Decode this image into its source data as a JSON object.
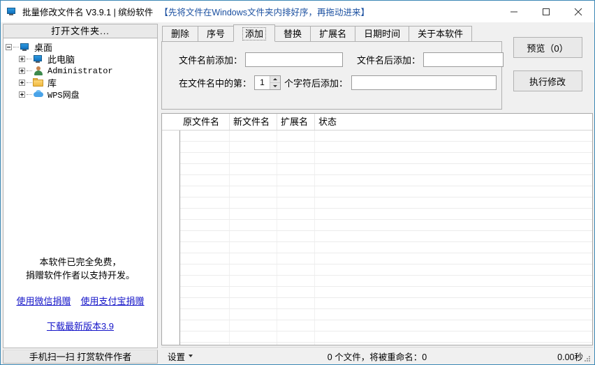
{
  "window": {
    "title": "批量修改文件名 V3.9.1 | 缤纷软件",
    "title_hint": "【先将文件在Windows文件夹内排好序，再拖动进来】",
    "icon": "monitor-icon",
    "controls": {
      "minimize": "—",
      "maximize": "□",
      "close": "✕"
    }
  },
  "sidebar": {
    "open_folder_label": "打开文件夹...",
    "tree": [
      {
        "label": "桌面",
        "level": 1,
        "expander": "minus",
        "icon": "desktop-monitor-icon"
      },
      {
        "label": "此电脑",
        "level": 2,
        "expander": "plus",
        "icon": "this-pc-monitor-icon"
      },
      {
        "label": "Administrator",
        "level": 2,
        "expander": "plus",
        "icon": "user-person-icon"
      },
      {
        "label": "库",
        "level": 2,
        "expander": "plus",
        "icon": "library-folder-icon"
      },
      {
        "label": "WPS网盘",
        "level": 2,
        "expander": "plus",
        "icon": "cloud-drive-icon"
      }
    ],
    "donate": {
      "line1": "本软件已完全免费，",
      "line2": "捐赠软件作者以支持开发。",
      "wechat_link": "使用微信捐赠",
      "alipay_link": "使用支付宝捐赠",
      "download_link": "下载最新版本3.9"
    },
    "scan_button": "手机扫一扫 打赏软件作者"
  },
  "tabs": [
    {
      "label": "删除",
      "selected": false
    },
    {
      "label": "序号",
      "selected": false
    },
    {
      "label": "添加",
      "selected": true
    },
    {
      "label": "替换",
      "selected": false
    },
    {
      "label": "扩展名",
      "selected": false
    },
    {
      "label": "日期时间",
      "selected": false
    },
    {
      "label": "关于本软件",
      "selected": false
    }
  ],
  "form": {
    "prefix_label": "文件名前添加：",
    "prefix_value": "",
    "suffix_label": "文件名后添加：",
    "suffix_value": "",
    "position_label_before": "在文件名中的第：",
    "position_value": "1",
    "position_label_after": "个字符后添加：",
    "position_insert_value": ""
  },
  "actions": {
    "preview_button": "预览（0）",
    "execute_button": "执行修改"
  },
  "table": {
    "columns": [
      "原文件名",
      "新文件名",
      "扩展名",
      "状态"
    ],
    "rows": []
  },
  "statusbar": {
    "settings_label": "设置",
    "count_text": "0 个文件，将被重命名：0",
    "elapsed": "0.00秒"
  }
}
